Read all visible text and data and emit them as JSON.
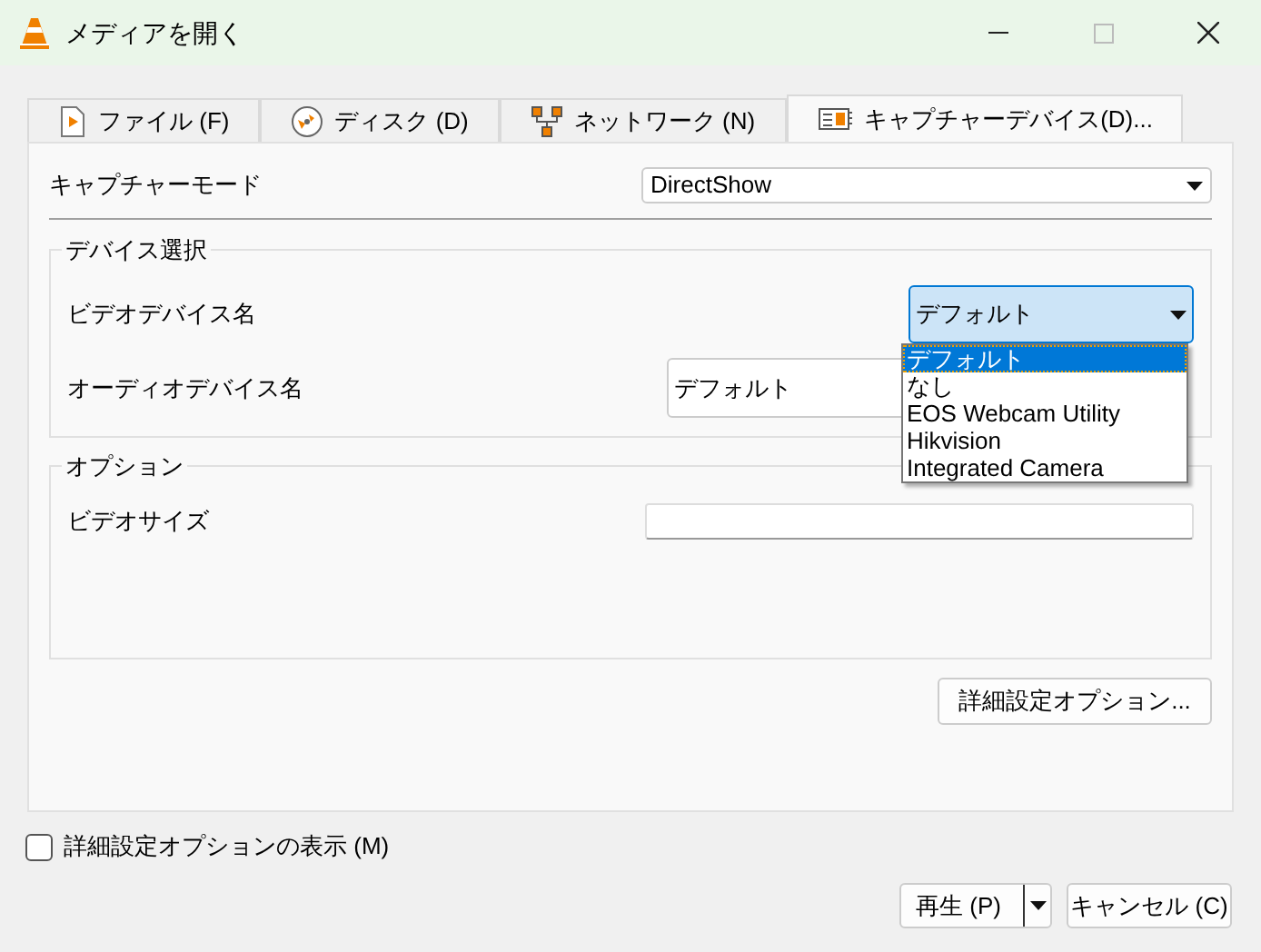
{
  "window": {
    "title": "メディアを開く"
  },
  "tabs": [
    {
      "label": "ファイル (F)",
      "kind": "file",
      "selected": false
    },
    {
      "label": "ディスク (D)",
      "kind": "disc",
      "selected": false
    },
    {
      "label": "ネットワーク (N)",
      "kind": "network",
      "selected": false
    },
    {
      "label": "キャプチャーデバイス(D)...",
      "kind": "capture",
      "selected": true
    }
  ],
  "capture_mode": {
    "label": "キャプチャーモード",
    "value": "DirectShow"
  },
  "device_group": {
    "title": "デバイス選択",
    "video": {
      "label": "ビデオデバイス名",
      "value": "デフォルト",
      "expanded": true,
      "options": [
        {
          "label": "デフォルト",
          "selected": true
        },
        {
          "label": "なし",
          "selected": false
        },
        {
          "label": "EOS Webcam Utility",
          "selected": false
        },
        {
          "label": "Hikvision",
          "selected": false
        },
        {
          "label": "Integrated Camera",
          "selected": false
        }
      ]
    },
    "audio": {
      "label": "オーディオデバイス名",
      "value": "デフォルト"
    }
  },
  "options_group": {
    "title": "オプション",
    "video_size": {
      "label": "ビデオサイズ"
    }
  },
  "advanced_button": "詳細設定オプション...",
  "show_advanced": {
    "label": "詳細設定オプションの表示 (M)",
    "checked": false
  },
  "buttons": {
    "play": "再生 (P)",
    "cancel": "キャンセル (C)"
  }
}
